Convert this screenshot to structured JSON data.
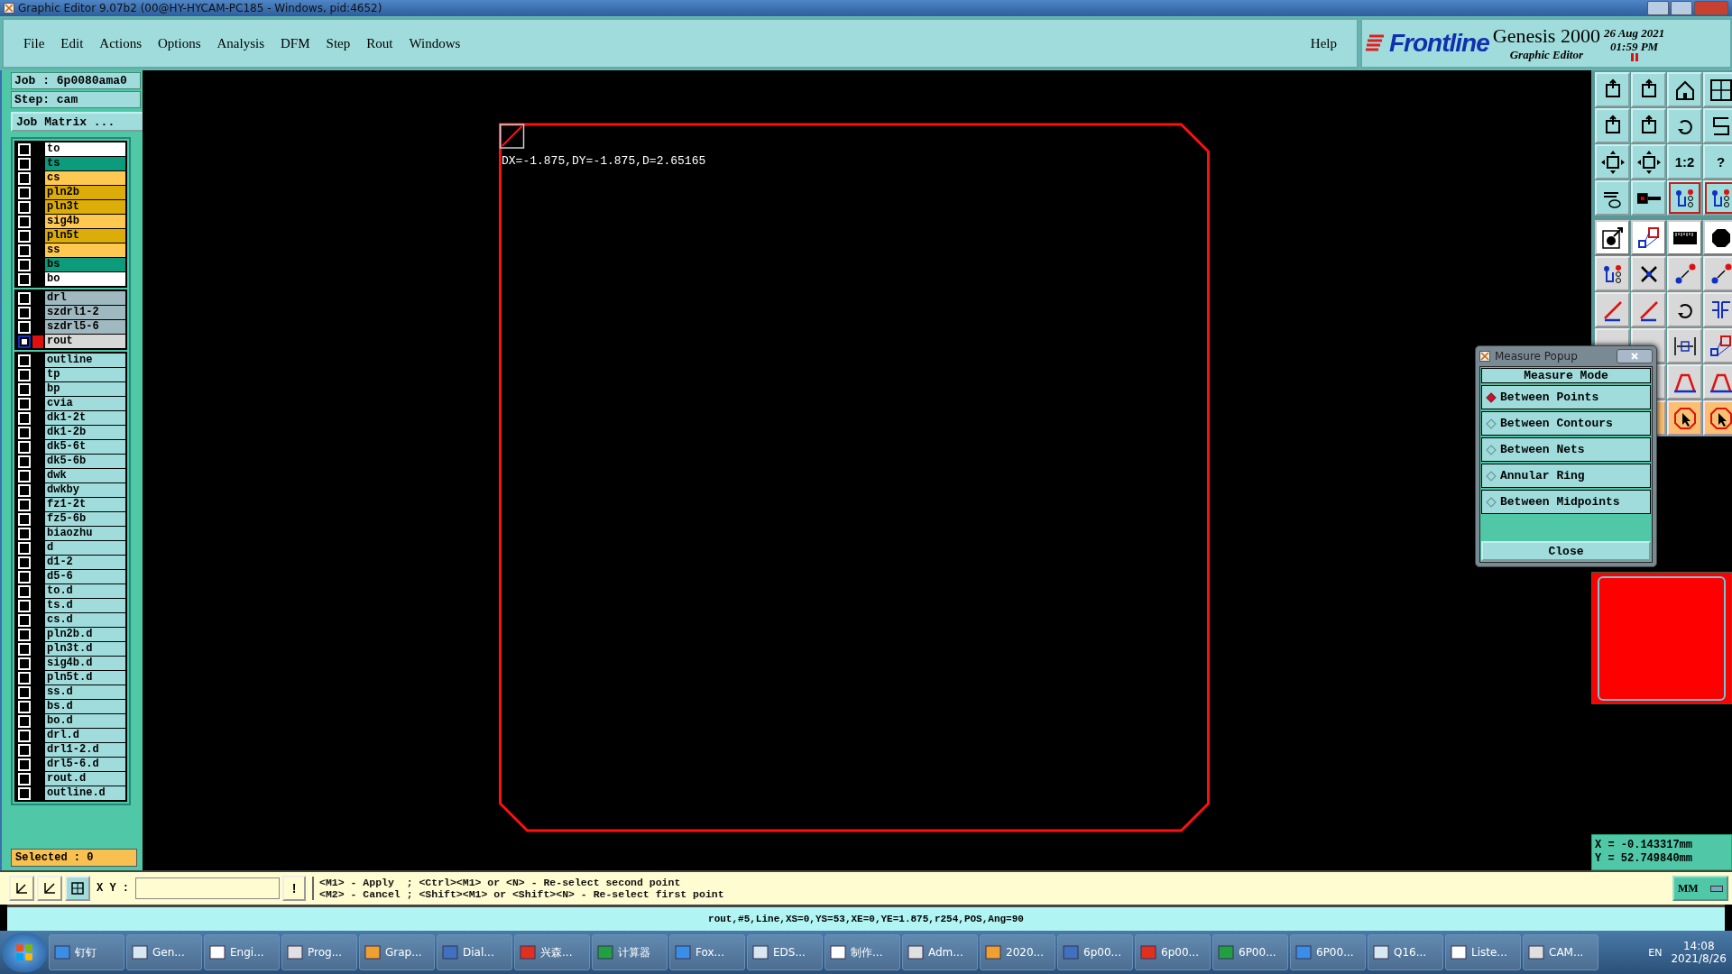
{
  "window": {
    "title": "Graphic Editor 9.07b2 (00@HY-HYCAM-PC185 - Windows, pid:4652)"
  },
  "menu": [
    "File",
    "Edit",
    "Actions",
    "Options",
    "Analysis",
    "DFM",
    "Step",
    "Rout",
    "Windows"
  ],
  "help_menu": "Help",
  "brand": {
    "logo": "Frontline",
    "product": "Genesis 2000",
    "subtitle": "Graphic Editor",
    "date": "26 Aug 2021",
    "time": "01:59 PM"
  },
  "job": {
    "job": "Job : 6p0080ama0",
    "step": "Step: cam",
    "matrix_button": "Job Matrix ..."
  },
  "layer_groups": [
    [
      {
        "name": "to",
        "color": "#ffffff",
        "work": false
      },
      {
        "name": "ts",
        "color": "#0c9c7c",
        "work": false
      },
      {
        "name": "cs",
        "color": "#ffc850",
        "work": false
      },
      {
        "name": "pln2b",
        "color": "#dcac08",
        "work": false
      },
      {
        "name": "pln3t",
        "color": "#dcac08",
        "work": false
      },
      {
        "name": "sig4b",
        "color": "#ffc850",
        "work": false
      },
      {
        "name": "pln5t",
        "color": "#dcac08",
        "work": false
      },
      {
        "name": "ss",
        "color": "#ffc850",
        "work": false
      },
      {
        "name": "bs",
        "color": "#0c9c7c",
        "work": false
      },
      {
        "name": "bo",
        "color": "#ffffff",
        "work": false
      }
    ],
    [
      {
        "name": "drl",
        "color": "#a0b8c0",
        "work": false
      },
      {
        "name": "szdrl1-2",
        "color": "#a0b8c0",
        "work": false
      },
      {
        "name": "szdrl5-6",
        "color": "#a0b8c0",
        "work": false
      },
      {
        "name": "rout",
        "color": "#d8d8d8",
        "work": true
      }
    ],
    [
      {
        "name": "outline",
        "color": "#a0dcdc",
        "work": false
      },
      {
        "name": "tp",
        "color": "#a0dcdc",
        "work": false
      },
      {
        "name": "bp",
        "color": "#a0dcdc",
        "work": false
      },
      {
        "name": "cvia",
        "color": "#a0dcdc",
        "work": false
      },
      {
        "name": "dk1-2t",
        "color": "#a0dcdc",
        "work": false
      },
      {
        "name": "dk1-2b",
        "color": "#a0dcdc",
        "work": false
      },
      {
        "name": "dk5-6t",
        "color": "#a0dcdc",
        "work": false
      },
      {
        "name": "dk5-6b",
        "color": "#a0dcdc",
        "work": false
      },
      {
        "name": "dwk",
        "color": "#a0dcdc",
        "work": false
      },
      {
        "name": "dwkby",
        "color": "#a0dcdc",
        "work": false
      },
      {
        "name": "fz1-2t",
        "color": "#a0dcdc",
        "work": false
      },
      {
        "name": "fz5-6b",
        "color": "#a0dcdc",
        "work": false
      },
      {
        "name": "biaozhu",
        "color": "#a0dcdc",
        "work": false
      },
      {
        "name": "d",
        "color": "#a0dcdc",
        "work": false
      },
      {
        "name": "d1-2",
        "color": "#a0dcdc",
        "work": false
      },
      {
        "name": "d5-6",
        "color": "#a0dcdc",
        "work": false
      },
      {
        "name": "to.d",
        "color": "#a0dcdc",
        "work": false
      },
      {
        "name": "ts.d",
        "color": "#a0dcdc",
        "work": false
      },
      {
        "name": "cs.d",
        "color": "#a0dcdc",
        "work": false
      },
      {
        "name": "pln2b.d",
        "color": "#a0dcdc",
        "work": false
      },
      {
        "name": "pln3t.d",
        "color": "#a0dcdc",
        "work": false
      },
      {
        "name": "sig4b.d",
        "color": "#a0dcdc",
        "work": false
      },
      {
        "name": "pln5t.d",
        "color": "#a0dcdc",
        "work": false
      },
      {
        "name": "ss.d",
        "color": "#a0dcdc",
        "work": false
      },
      {
        "name": "bs.d",
        "color": "#a0dcdc",
        "work": false
      },
      {
        "name": "bo.d",
        "color": "#a0dcdc",
        "work": false
      },
      {
        "name": "drl.d",
        "color": "#a0dcdc",
        "work": false
      },
      {
        "name": "drl1-2.d",
        "color": "#a0dcdc",
        "work": false
      },
      {
        "name": "drl5-6.d",
        "color": "#a0dcdc",
        "work": false
      },
      {
        "name": "rout.d",
        "color": "#a0dcdc",
        "work": false
      },
      {
        "name": "outline.d",
        "color": "#a0dcdc",
        "work": false
      }
    ]
  ],
  "selected_count": "Selected : 0",
  "canvas": {
    "measure_readout": "DX=-1.875,DY=-1.875,D=2.65165"
  },
  "toolbar_texts": [
    "1:2",
    "?"
  ],
  "measure_popup": {
    "title": "Measure Popup",
    "heading": "Measure Mode",
    "options": [
      {
        "label": "Between Points",
        "selected": true
      },
      {
        "label": "Between Contours",
        "selected": false
      },
      {
        "label": "Between Nets",
        "selected": false
      },
      {
        "label": "Annular Ring",
        "selected": false
      },
      {
        "label": "Between Midpoints",
        "selected": false
      }
    ],
    "close_button": "Close"
  },
  "coordinates": {
    "x": "X = -0.143317mm",
    "y": "Y = 52.749840mm"
  },
  "command_bar": {
    "xy_label": "X Y :",
    "bang_button": "!",
    "hints": [
      "<M1> - Apply  ; <Ctrl><M1> or <N> - Re-select second point",
      "<M2> - Cancel ; <Shift><M1> or <Shift><N> - Re-select first point"
    ],
    "units": "MM"
  },
  "status_line": "rout,#5,Line,XS=0,YS=53,XE=0,YE=1.875,r254,POS,Ang=90",
  "taskbar": {
    "items": [
      "钉钉",
      "Gen...",
      "Engi...",
      "Prog...",
      "Grap...",
      "Dial...",
      "兴森...",
      "计算器",
      "Fox...",
      "EDS...",
      "制作...",
      "Adm...",
      "2020...",
      "6p00...",
      "6p00...",
      "6P00...",
      "6P00...",
      "Q16...",
      "Liste...",
      "CAM..."
    ],
    "language": "EN",
    "time": "14:08",
    "date": "2021/8/26"
  }
}
